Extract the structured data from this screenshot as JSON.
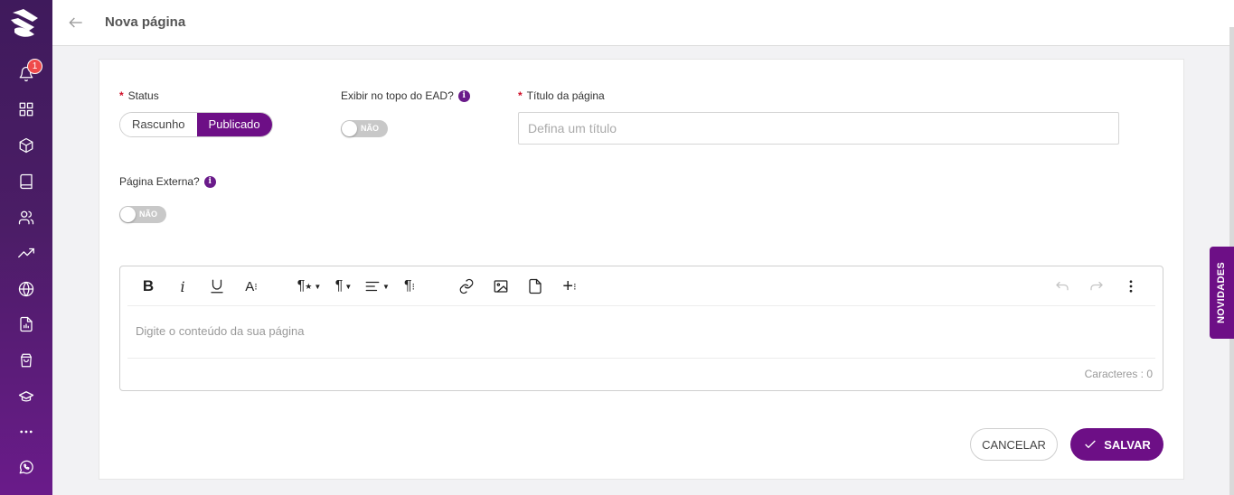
{
  "sidebar": {
    "notification_count": "1",
    "items": [
      {
        "icon": "bell-icon"
      },
      {
        "icon": "grid-icon"
      },
      {
        "icon": "cube-icon"
      },
      {
        "icon": "book-icon"
      },
      {
        "icon": "users-icon"
      },
      {
        "icon": "trending-up-icon"
      },
      {
        "icon": "globe-icon"
      },
      {
        "icon": "report-icon"
      },
      {
        "icon": "shopping-bag-icon"
      },
      {
        "icon": "graduation-cap-icon"
      },
      {
        "icon": "more-icon"
      },
      {
        "icon": "whatsapp-icon"
      }
    ]
  },
  "header": {
    "title": "Nova página"
  },
  "form": {
    "status": {
      "label": "Status",
      "options": [
        "Rascunho",
        "Publicado"
      ],
      "selected": "Publicado"
    },
    "show_top": {
      "label": "Exibir no topo do EAD?",
      "value": "NÃO"
    },
    "page_title": {
      "label": "Título da página",
      "placeholder": "Defina um título",
      "value": ""
    },
    "external_page": {
      "label": "Página Externa?",
      "value": "NÃO"
    }
  },
  "editor": {
    "placeholder": "Digite o conteúdo da sua página",
    "char_count": "Caracteres : 0",
    "toolbar": [
      "bold",
      "italic",
      "underline",
      "text-size",
      "paragraph-style",
      "paragraph-format",
      "align",
      "more-text",
      "link",
      "image",
      "file",
      "more-insert",
      "undo",
      "redo",
      "more-options"
    ]
  },
  "actions": {
    "cancel": "CANCELAR",
    "save": "SALVAR"
  },
  "side_tab": {
    "label": "NOVIDADES"
  },
  "colors": {
    "primary": "#6d0f86",
    "sidebar": "#4b1d66",
    "badge": "#ef4a4a"
  }
}
